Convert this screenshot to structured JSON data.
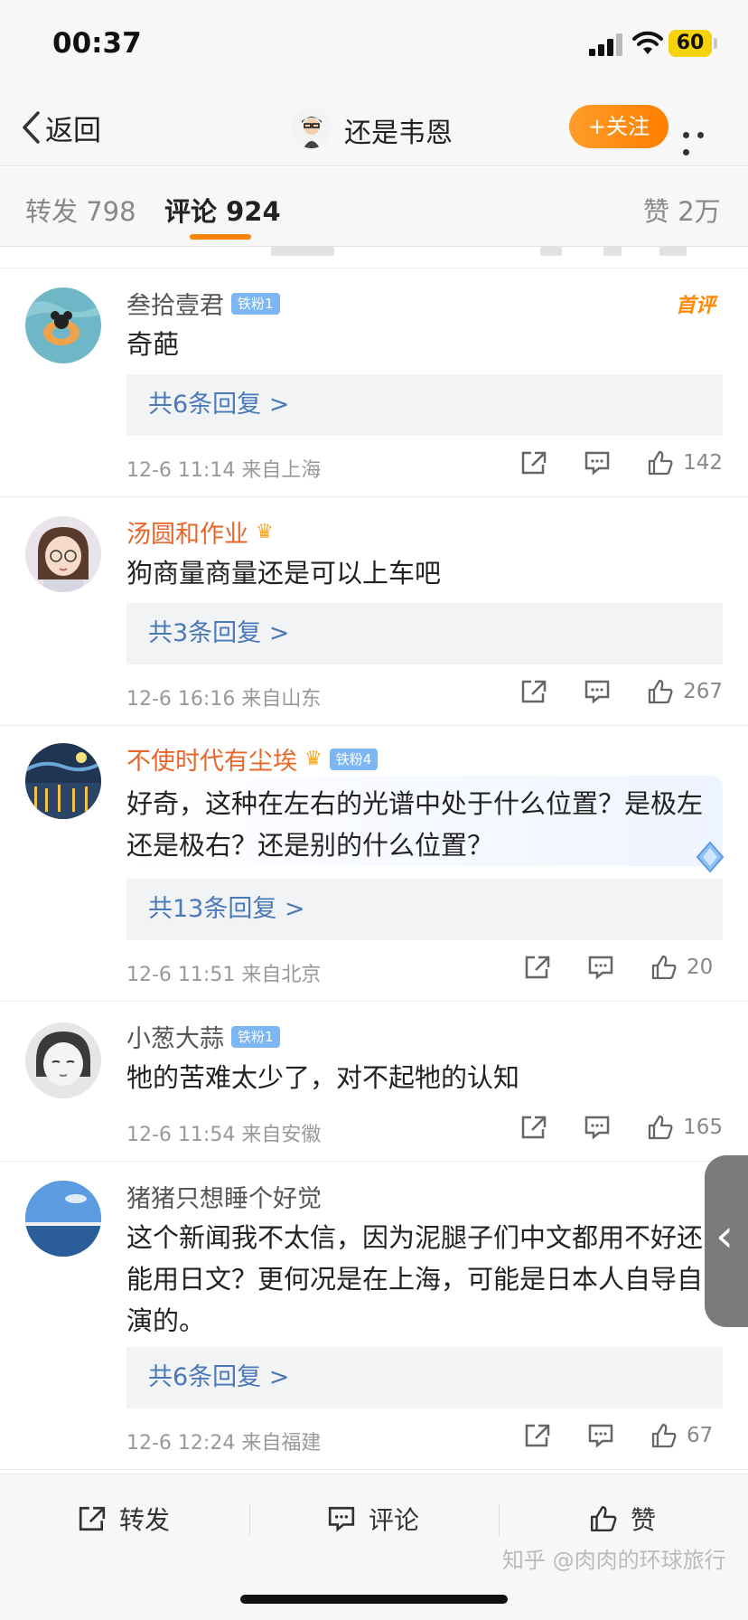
{
  "status": {
    "time": "00:37",
    "battery": "60"
  },
  "nav": {
    "back_label": "返回",
    "title": "还是韦恩",
    "follow_label": "+关注"
  },
  "tabs": {
    "repost": "转发 798",
    "comments": "评论 924",
    "likes": "赞 2万"
  },
  "comments": [
    {
      "name": "叁拾壹君",
      "badge": "铁粉1",
      "first_label": "首评",
      "text": "奇葩",
      "replies": "共6条回复 >",
      "time": "12-6 11:14",
      "location": "来自上海",
      "likes": "142"
    },
    {
      "name": "汤圆和作业",
      "text": "狗商量商量还是可以上车吧",
      "replies": "共3条回复 >",
      "time": "12-6 16:16",
      "location": "来自山东",
      "likes": "267"
    },
    {
      "name": "不使时代有尘埃",
      "badge": "铁粉4",
      "text": "好奇，这种在左右的光谱中处于什么位置？是极左还是极右？还是别的什么位置？",
      "replies": "共13条回复 >",
      "time": "12-6 11:51",
      "location": "来自北京",
      "likes": "20"
    },
    {
      "name": "小葱大蒜",
      "badge": "铁粉1",
      "text": "牠的苦难太少了，对不起牠的认知",
      "time": "12-6 11:54",
      "location": "来自安徽",
      "likes": "165"
    },
    {
      "name": "猪猪只想睡个好觉",
      "text": "这个新闻我不太信，因为泥腿子们中文都用不好还能用日文？更何况是在上海，可能是日本人自导自演的。",
      "replies": "共6条回复 >",
      "time": "12-6 12:24",
      "location": "来自福建",
      "likes": "67"
    }
  ],
  "bottom": {
    "repost": "转发",
    "comment": "评论",
    "like": "赞",
    "watermark": "知乎 @肉肉的环球旅行"
  },
  "colors": {
    "accent": "#ff8200",
    "link": "#4a79b8",
    "name_orange": "#e8662b"
  }
}
